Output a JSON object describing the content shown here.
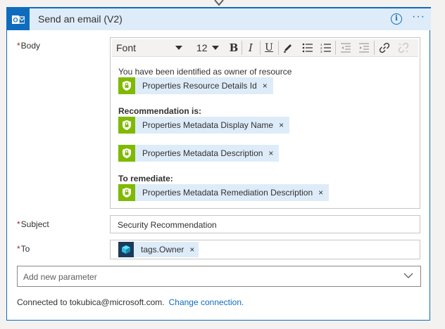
{
  "header": {
    "title": "Send an email (V2)",
    "info_glyph": "i",
    "more_glyph": "···",
    "app_icon": "outlook-icon"
  },
  "body": {
    "label": "Body",
    "toolbar": {
      "font": "Font",
      "size": "12",
      "buttons": [
        "bold",
        "italic",
        "underline",
        "highlight",
        "bulleted-list",
        "numbered-list",
        "decrease-indent",
        "increase-indent",
        "link",
        "unlink"
      ],
      "bold_glyph": "B",
      "italic_glyph": "I",
      "underline_glyph": "U"
    },
    "lines": {
      "intro": "You have been identified as owner of resource",
      "recommendation_heading": "Recommendation is:",
      "remediate_heading": "To remediate:"
    },
    "tokens": {
      "resource_id": "Properties Resource Details Id",
      "display_name": "Properties Metadata Display Name",
      "description": "Properties Metadata Description",
      "remediation": "Properties Metadata Remediation Description"
    },
    "token_close": "×"
  },
  "subject": {
    "label": "Subject",
    "value": "Security Recommendation"
  },
  "to": {
    "label": "To",
    "token": "tags.Owner",
    "token_close": "×"
  },
  "add_param": {
    "placeholder": "Add new parameter"
  },
  "footer": {
    "connected": "Connected to tokubica@microsoft.com.",
    "change": "Change connection."
  },
  "required_mark": "*",
  "colors": {
    "accent": "#0f6cbd",
    "header_bg": "#deecf9",
    "token_bg": "#deecf9",
    "security_icon_bg": "#7fba00",
    "required": "#a4262c"
  }
}
